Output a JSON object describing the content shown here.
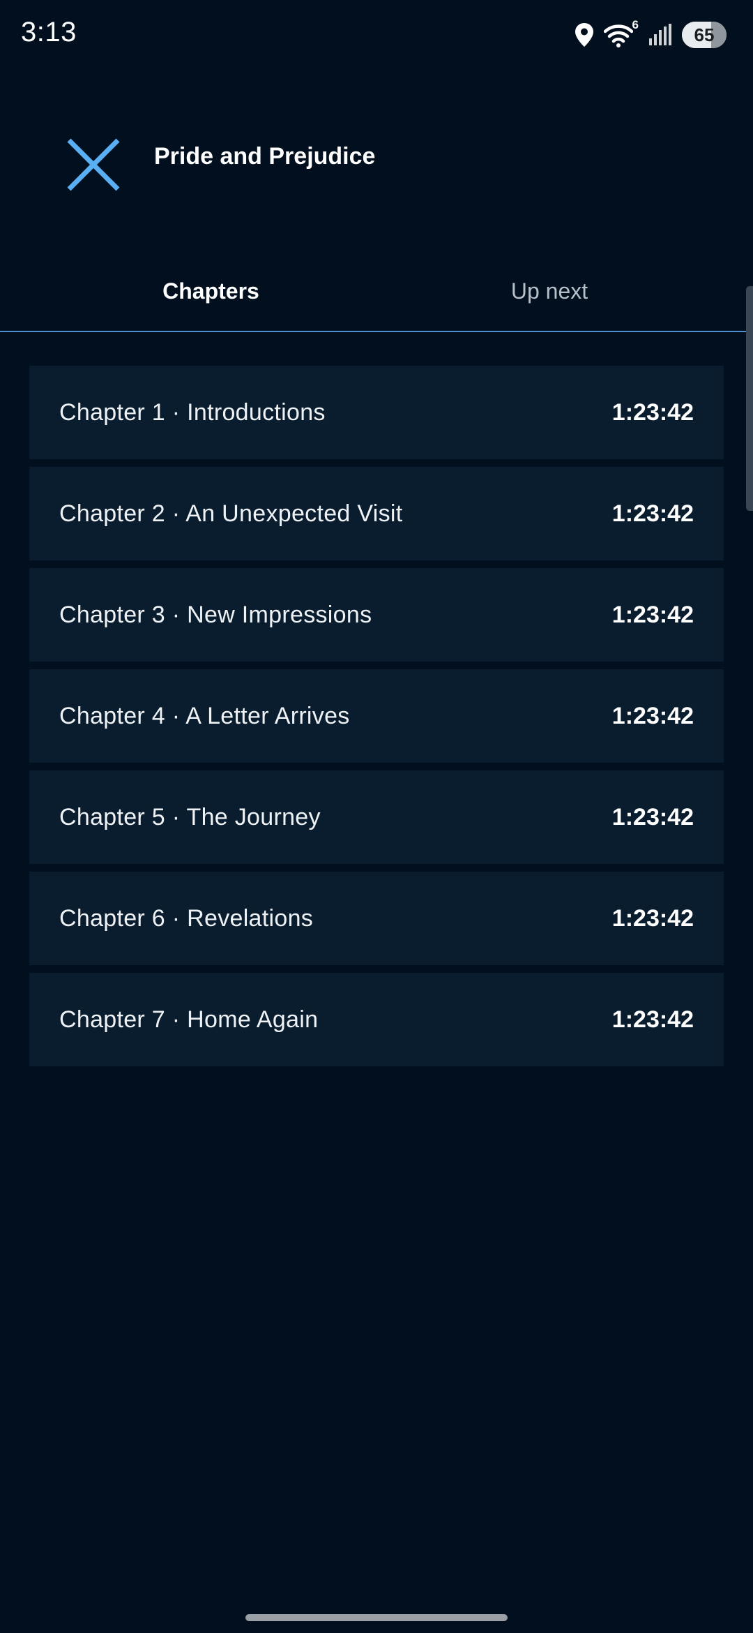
{
  "status_bar": {
    "time": "3:13",
    "wifi_badge": "6",
    "battery_level": "65",
    "icons": [
      "location-icon",
      "wifi-icon",
      "signal-icon",
      "battery-icon"
    ]
  },
  "header": {
    "title": "Pride and Prejudice",
    "close_icon": "close-icon"
  },
  "tabs": [
    {
      "label": "Chapters",
      "active": true
    },
    {
      "label": "Up next",
      "active": false
    }
  ],
  "chapters": [
    {
      "title": "Chapter 1 · Introductions",
      "duration": "1:23:42"
    },
    {
      "title": "Chapter 2 · An Unexpected Visit",
      "duration": "1:23:42"
    },
    {
      "title": "Chapter 3 · New Impressions",
      "duration": "1:23:42"
    },
    {
      "title": "Chapter 4 · A Letter Arrives",
      "duration": "1:23:42"
    },
    {
      "title": "Chapter 5 · The Journey",
      "duration": "1:23:42"
    },
    {
      "title": "Chapter 6 · Revelations",
      "duration": "1:23:42"
    },
    {
      "title": "Chapter 7 · Home Again",
      "duration": "1:23:42"
    }
  ],
  "colors": {
    "background": "#010f1e",
    "row_background": "#0a1d2e",
    "accent": "#5aaef2",
    "tab_underline": "#4f8fcf"
  }
}
